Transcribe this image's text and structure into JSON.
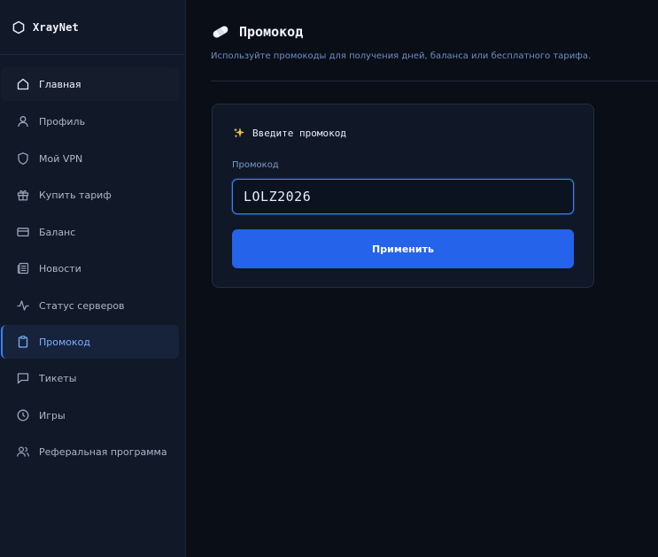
{
  "brand": {
    "name": "XrayNet",
    "icon": "hexagon-icon"
  },
  "sidebar": {
    "items": [
      {
        "label": "Главная",
        "icon": "home-icon"
      },
      {
        "label": "Профиль",
        "icon": "user-icon"
      },
      {
        "label": "Мой VPN",
        "icon": "shield-icon"
      },
      {
        "label": "Купить тариф",
        "icon": "gift-icon"
      },
      {
        "label": "Баланс",
        "icon": "credit-card-icon"
      },
      {
        "label": "Новости",
        "icon": "newspaper-icon"
      },
      {
        "label": "Статус серверов",
        "icon": "activity-icon"
      },
      {
        "label": "Промокод",
        "icon": "clipboard-icon"
      },
      {
        "label": "Тикеты",
        "icon": "message-square-icon"
      },
      {
        "label": "Игры",
        "icon": "clock-icon"
      },
      {
        "label": "Реферальная программа",
        "icon": "users-icon"
      }
    ],
    "active_index": 7
  },
  "page": {
    "title": "Промокод",
    "title_icon": "bandage-icon",
    "subtitle": "Используйте промокоды для получения дней, баланса или бесплатного тарифа."
  },
  "promo_card": {
    "title": "Введите промокод",
    "title_icon": "sparkles-icon",
    "field_label": "Промокод",
    "input_value": "LOLZ2026",
    "button_label": "Применить"
  },
  "colors": {
    "accent": "#2563eb",
    "active_text": "#7fb0ff",
    "sidebar_bg": "#111827",
    "page_bg": "#0a0e17"
  }
}
